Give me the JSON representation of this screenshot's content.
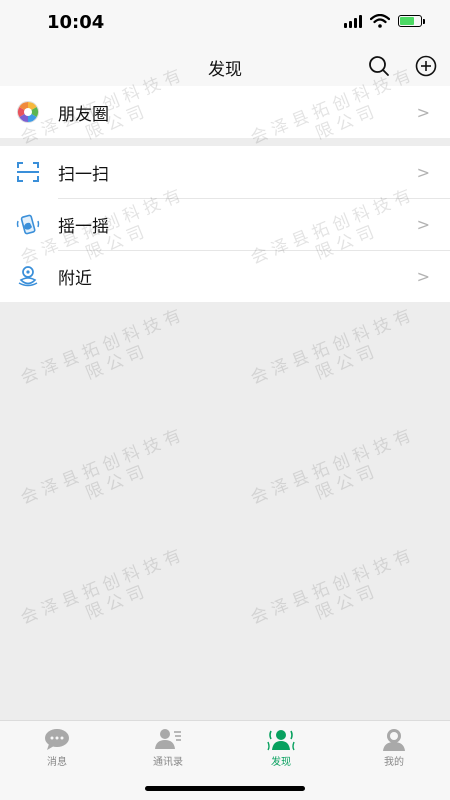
{
  "status_bar": {
    "time": "10:04"
  },
  "nav": {
    "title": "发现"
  },
  "menu": {
    "moments": "朋友圈",
    "scan": "扫一扫",
    "shake": "摇一摇",
    "nearby": "附近",
    "arrow": ">"
  },
  "watermark": {
    "line1": "会泽县拓创科技有",
    "line2": "限公司"
  },
  "tabs": [
    {
      "label": "消息"
    },
    {
      "label": "通讯录"
    },
    {
      "label": "发现"
    },
    {
      "label": "我的"
    }
  ],
  "colors": {
    "accent": "#07a05e",
    "background": "#ededed",
    "arrow": "#b2b2b2"
  }
}
